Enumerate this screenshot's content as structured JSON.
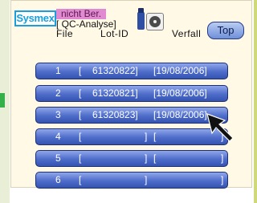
{
  "app": {
    "logo_text": "Sysmex",
    "status_line1": "nicht Ber.",
    "status_line2": "[ QC-Analyse]",
    "top_button_label": "Top"
  },
  "columns": {
    "file": "File",
    "lot_id": "Lot-ID",
    "expiry": "Verfall"
  },
  "rows": [
    {
      "num": "1",
      "open": "[",
      "lot": "61320822]",
      "date": "[19/08/2006]"
    },
    {
      "num": "2",
      "open": "[",
      "lot": "61320821]",
      "date": "[19/08/2006]"
    },
    {
      "num": "3",
      "open": "[",
      "lot": "61320823]",
      "date": "[19/08/2006]"
    },
    {
      "num": "4",
      "open": "[",
      "lot": "]",
      "date": "["
    },
    {
      "num": "5",
      "open": "[",
      "lot": "]",
      "date": "["
    },
    {
      "num": "6",
      "open": "[",
      "lot": "]",
      "date": "]"
    }
  ],
  "row_tail": [
    "",
    "",
    "",
    "]",
    "]",
    ""
  ],
  "icons": {
    "logo": "sysmex-logo",
    "storage": "card-icon",
    "disk": "disk-icon",
    "cursor": "arrow-cursor-icon"
  }
}
